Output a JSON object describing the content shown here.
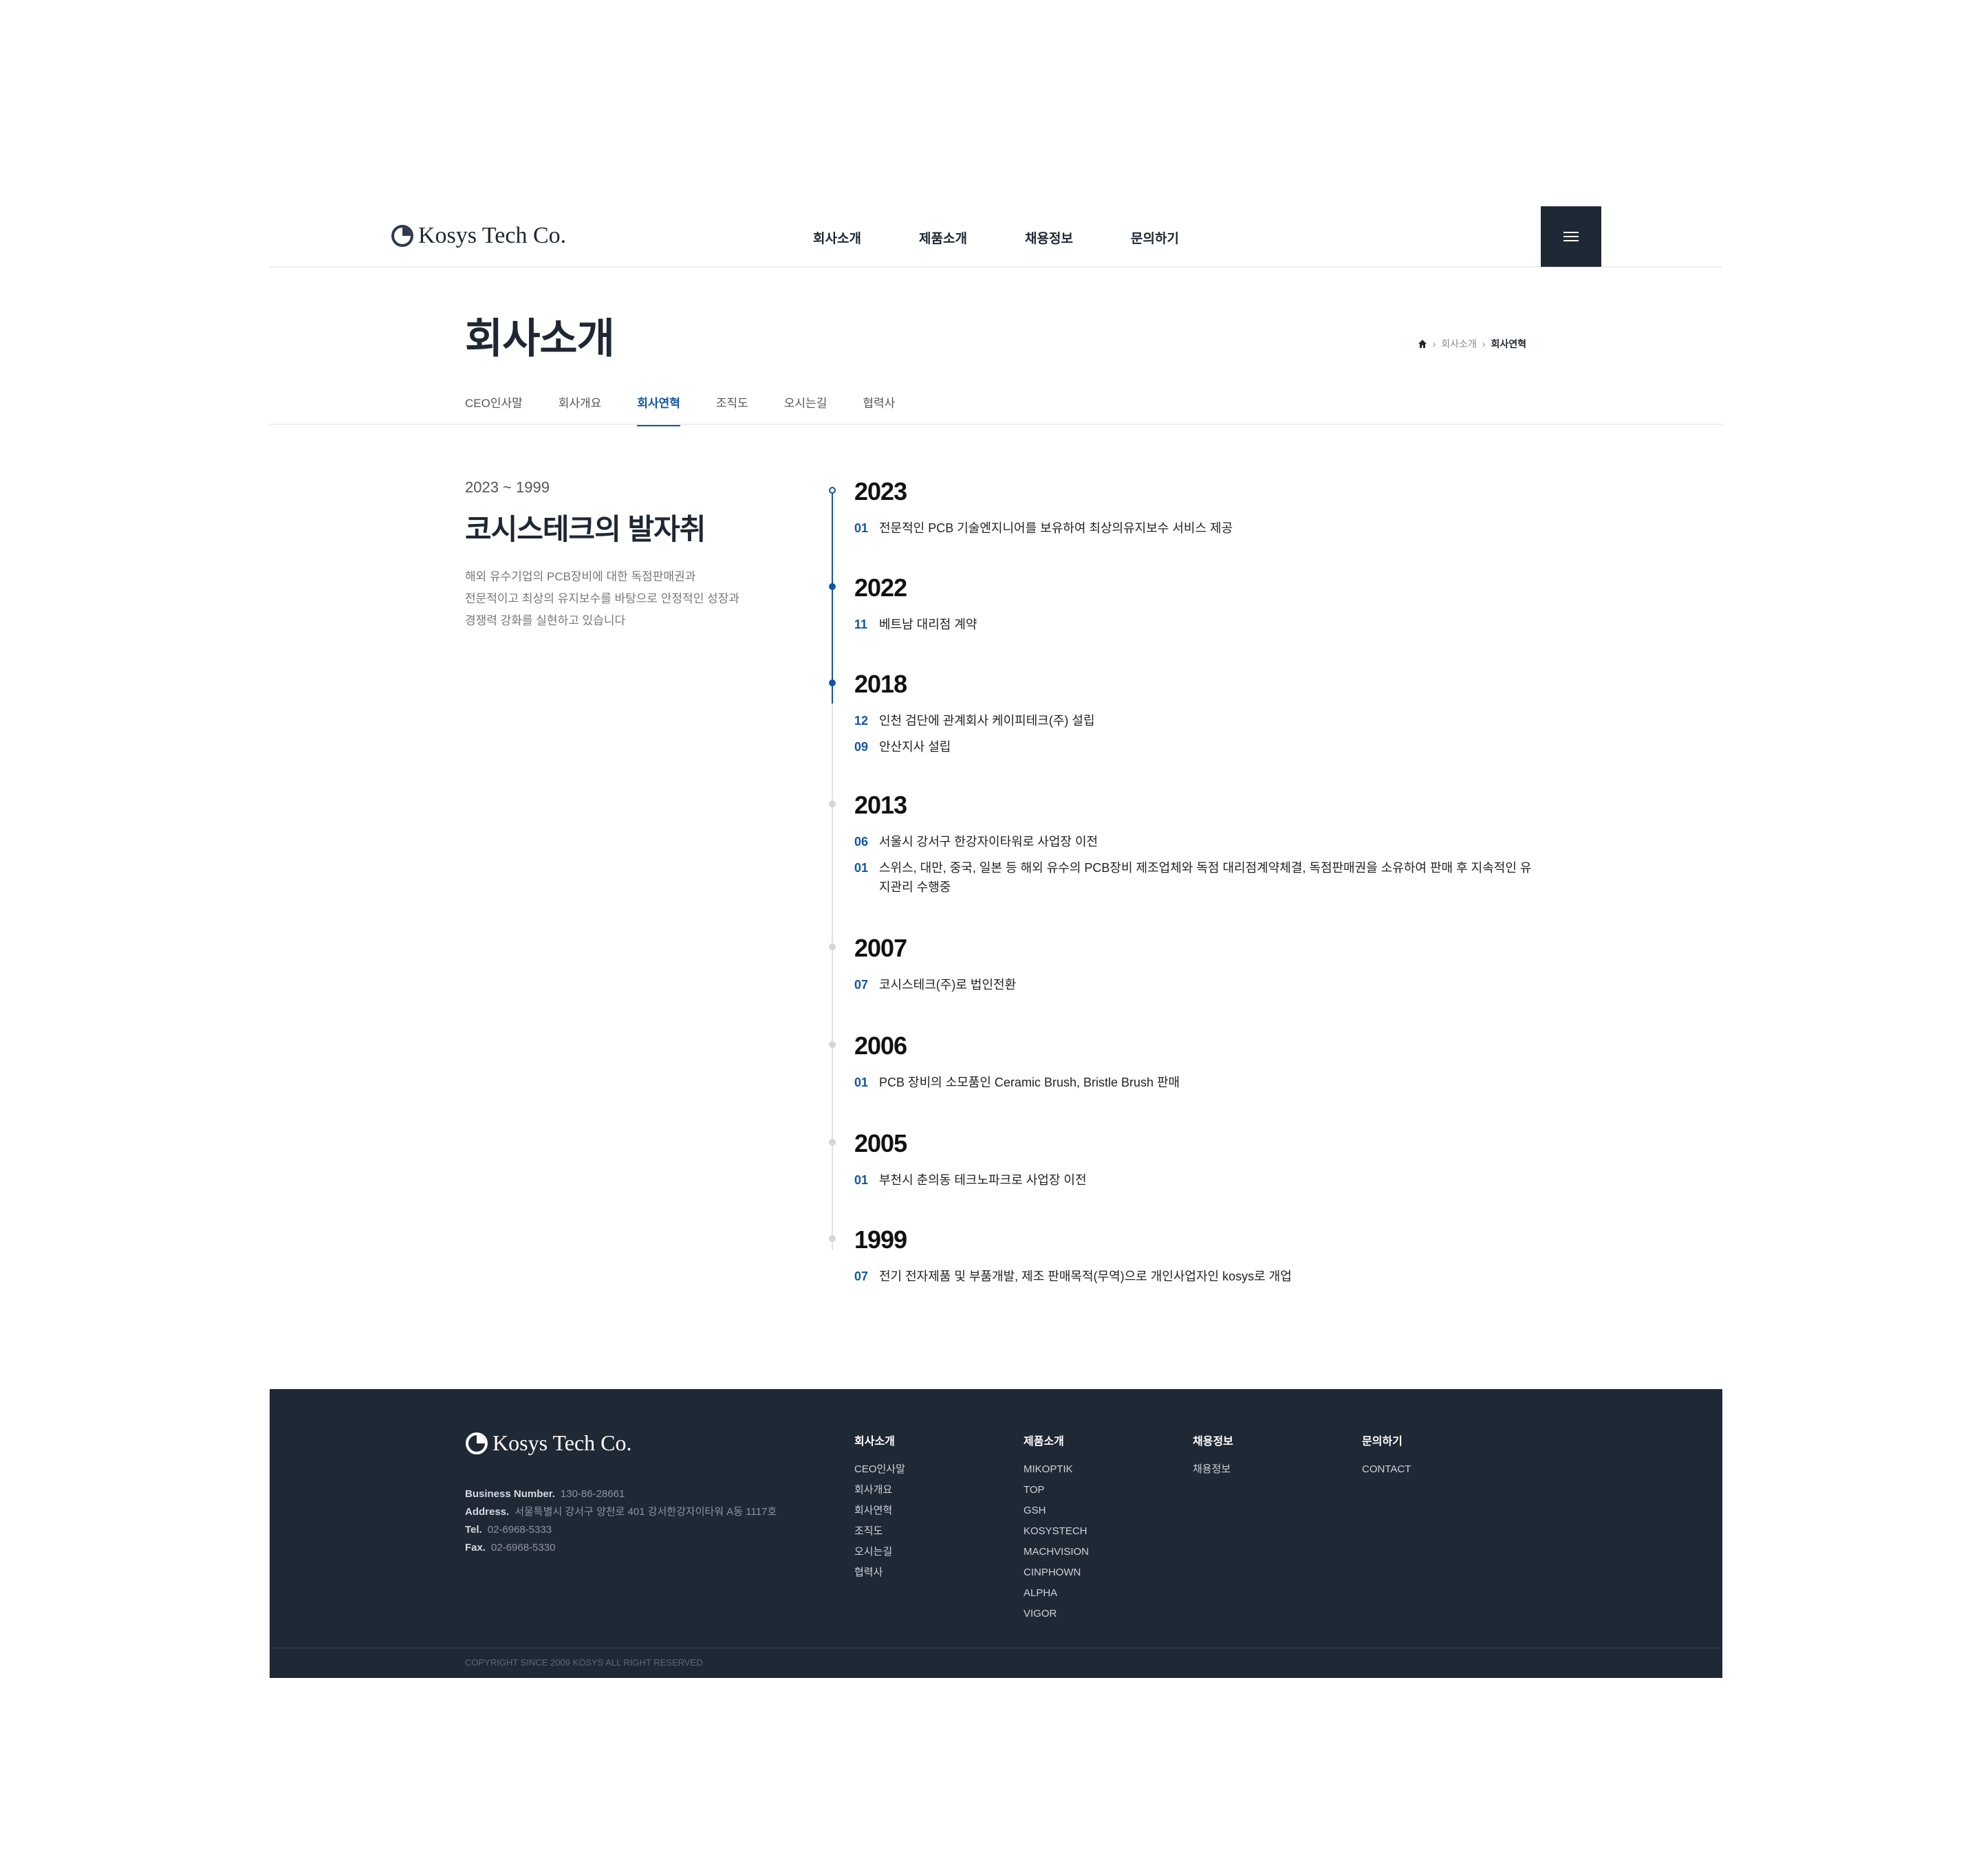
{
  "brand": {
    "logo_text": "Kosys Tech Co.",
    "accent": "#1256a3",
    "dark": "#1f2835"
  },
  "gnb": [
    "회사소개",
    "제품소개",
    "채용정보",
    "문의하기"
  ],
  "page_title": "회사소개",
  "breadcrumb": {
    "parent": "회사소개",
    "current": "회사연혁"
  },
  "subnav": [
    "CEO인사말",
    "회사개요",
    "회사연혁",
    "조직도",
    "오시는길",
    "협력사"
  ],
  "subnav_active": "회사연혁",
  "intro": {
    "range": "2023 ~ 1999",
    "title": "코시스테크의 발자취",
    "desc": [
      "해외 유수기업의 PCB장비에 대한 독점판매권과",
      "전문적이고 최상의 유지보수를 바탕으로 안정적인 성장과",
      "경쟁력 강화를 실현하고 있습니다"
    ]
  },
  "history": [
    {
      "year": "2023",
      "entries": [
        {
          "month": "01",
          "text": "전문적인 PCB 기술엔지니어를 보유하여 최상의유지보수 서비스 제공"
        }
      ]
    },
    {
      "year": "2022",
      "entries": [
        {
          "month": "11",
          "text": "베트남 대리점 계약"
        }
      ]
    },
    {
      "year": "2018",
      "entries": [
        {
          "month": "12",
          "text": "인천 검단에 관계회사 케이피테크(주) 설립"
        },
        {
          "month": "09",
          "text": "안산지사 설립"
        }
      ]
    },
    {
      "year": "2013",
      "entries": [
        {
          "month": "06",
          "text": "서울시 강서구 한강자이타워로 사업장 이전"
        },
        {
          "month": "01",
          "text": "스위스, 대만, 중국, 일본 등 해외 유수의 PCB장비 제조업체와 독점 대리점계약체결, 독점판매권을 소유하여 판매 후 지속적인 유지관리 수행중"
        }
      ]
    },
    {
      "year": "2007",
      "entries": [
        {
          "month": "07",
          "text": "코시스테크(주)로 법인전환"
        }
      ]
    },
    {
      "year": "2006",
      "entries": [
        {
          "month": "01",
          "text": "PCB 장비의 소모품인 Ceramic Brush, Bristle Brush 판매"
        }
      ]
    },
    {
      "year": "2005",
      "entries": [
        {
          "month": "01",
          "text": "부천시 춘의동 테크노파크로 사업장 이전"
        }
      ]
    },
    {
      "year": "1999",
      "entries": [
        {
          "month": "07",
          "text": "전기 전자제품 및 부품개발, 제조 판매목적(무역)으로 개인사업자인 kosys로 개업"
        }
      ]
    }
  ],
  "footer": {
    "logo_text": "Kosys Tech Co.",
    "business_label": "Business Number.",
    "business_value": "130-86-28661",
    "address_label": "Address.",
    "address_value": "서울특별시 강서구 양천로 401 강서한강자이타워 A동 1117호",
    "tel_label": "Tel.",
    "tel_value": "02-6968-5333",
    "fax_label": "Fax.",
    "fax_value": "02-6968-5330",
    "columns": [
      {
        "title": "회사소개",
        "links": [
          "CEO인사말",
          "회사개요",
          "회사연혁",
          "조직도",
          "오시는길",
          "협력사"
        ]
      },
      {
        "title": "제품소개",
        "links": [
          "MIKOPTIK",
          "TOP",
          "GSH",
          "KOSYSTECH",
          "MACHVISION",
          "CINPHOWN",
          "ALPHA",
          "VIGOR"
        ]
      },
      {
        "title": "채용정보",
        "links": [
          "채용정보"
        ]
      },
      {
        "title": "문의하기",
        "links": [
          "CONTACT"
        ]
      }
    ],
    "copyright": "COPYRIGHT SINCE 2009 KOSYS ALL RIGHT RESERVED"
  }
}
